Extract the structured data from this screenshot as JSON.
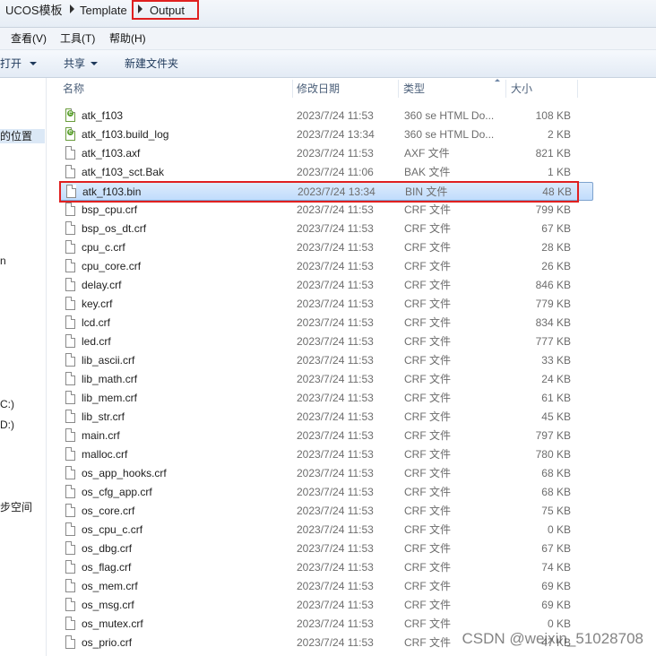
{
  "address": {
    "crumbs": [
      "UCOS模板",
      "Template",
      "Output"
    ]
  },
  "menu": {
    "items": [
      "查看(V)",
      "工具(T)",
      "帮助(H)"
    ]
  },
  "toolbar": {
    "open": "打开",
    "share": "共享",
    "new_folder": "新建文件夹"
  },
  "nav": {
    "items": [
      "的位置",
      "n",
      "C:)",
      "D:)",
      "步空间"
    ]
  },
  "columns": {
    "name": "名称",
    "date": "修改日期",
    "type": "类型",
    "size": "大小"
  },
  "files": [
    {
      "name": "atk_f103",
      "date": "2023/7/24 11:53",
      "type": "360 se HTML Do...",
      "size": "108 KB",
      "icon": "html-file-icon"
    },
    {
      "name": "atk_f103.build_log",
      "date": "2023/7/24 13:34",
      "type": "360 se HTML Do...",
      "size": "2 KB",
      "icon": "html-file-icon"
    },
    {
      "name": "atk_f103.axf",
      "date": "2023/7/24 11:53",
      "type": "AXF 文件",
      "size": "821 KB",
      "icon": "file-icon"
    },
    {
      "name": "atk_f103_sct.Bak",
      "date": "2023/7/24 11:06",
      "type": "BAK 文件",
      "size": "1 KB",
      "icon": "file-icon"
    },
    {
      "name": "atk_f103.bin",
      "date": "2023/7/24 13:34",
      "type": "BIN 文件",
      "size": "48 KB",
      "icon": "file-icon",
      "selected": true
    },
    {
      "name": "bsp_cpu.crf",
      "date": "2023/7/24 11:53",
      "type": "CRF 文件",
      "size": "799 KB",
      "icon": "file-icon"
    },
    {
      "name": "bsp_os_dt.crf",
      "date": "2023/7/24 11:53",
      "type": "CRF 文件",
      "size": "67 KB",
      "icon": "file-icon"
    },
    {
      "name": "cpu_c.crf",
      "date": "2023/7/24 11:53",
      "type": "CRF 文件",
      "size": "28 KB",
      "icon": "file-icon"
    },
    {
      "name": "cpu_core.crf",
      "date": "2023/7/24 11:53",
      "type": "CRF 文件",
      "size": "26 KB",
      "icon": "file-icon"
    },
    {
      "name": "delay.crf",
      "date": "2023/7/24 11:53",
      "type": "CRF 文件",
      "size": "846 KB",
      "icon": "file-icon"
    },
    {
      "name": "key.crf",
      "date": "2023/7/24 11:53",
      "type": "CRF 文件",
      "size": "779 KB",
      "icon": "file-icon"
    },
    {
      "name": "lcd.crf",
      "date": "2023/7/24 11:53",
      "type": "CRF 文件",
      "size": "834 KB",
      "icon": "file-icon"
    },
    {
      "name": "led.crf",
      "date": "2023/7/24 11:53",
      "type": "CRF 文件",
      "size": "777 KB",
      "icon": "file-icon"
    },
    {
      "name": "lib_ascii.crf",
      "date": "2023/7/24 11:53",
      "type": "CRF 文件",
      "size": "33 KB",
      "icon": "file-icon"
    },
    {
      "name": "lib_math.crf",
      "date": "2023/7/24 11:53",
      "type": "CRF 文件",
      "size": "24 KB",
      "icon": "file-icon"
    },
    {
      "name": "lib_mem.crf",
      "date": "2023/7/24 11:53",
      "type": "CRF 文件",
      "size": "61 KB",
      "icon": "file-icon"
    },
    {
      "name": "lib_str.crf",
      "date": "2023/7/24 11:53",
      "type": "CRF 文件",
      "size": "45 KB",
      "icon": "file-icon"
    },
    {
      "name": "main.crf",
      "date": "2023/7/24 11:53",
      "type": "CRF 文件",
      "size": "797 KB",
      "icon": "file-icon"
    },
    {
      "name": "malloc.crf",
      "date": "2023/7/24 11:53",
      "type": "CRF 文件",
      "size": "780 KB",
      "icon": "file-icon"
    },
    {
      "name": "os_app_hooks.crf",
      "date": "2023/7/24 11:53",
      "type": "CRF 文件",
      "size": "68 KB",
      "icon": "file-icon"
    },
    {
      "name": "os_cfg_app.crf",
      "date": "2023/7/24 11:53",
      "type": "CRF 文件",
      "size": "68 KB",
      "icon": "file-icon"
    },
    {
      "name": "os_core.crf",
      "date": "2023/7/24 11:53",
      "type": "CRF 文件",
      "size": "75 KB",
      "icon": "file-icon"
    },
    {
      "name": "os_cpu_c.crf",
      "date": "2023/7/24 11:53",
      "type": "CRF 文件",
      "size": "0 KB",
      "icon": "file-icon"
    },
    {
      "name": "os_dbg.crf",
      "date": "2023/7/24 11:53",
      "type": "CRF 文件",
      "size": "67 KB",
      "icon": "file-icon"
    },
    {
      "name": "os_flag.crf",
      "date": "2023/7/24 11:53",
      "type": "CRF 文件",
      "size": "74 KB",
      "icon": "file-icon"
    },
    {
      "name": "os_mem.crf",
      "date": "2023/7/24 11:53",
      "type": "CRF 文件",
      "size": "69 KB",
      "icon": "file-icon"
    },
    {
      "name": "os_msg.crf",
      "date": "2023/7/24 11:53",
      "type": "CRF 文件",
      "size": "69 KB",
      "icon": "file-icon"
    },
    {
      "name": "os_mutex.crf",
      "date": "2023/7/24 11:53",
      "type": "CRF 文件",
      "size": "0 KB",
      "icon": "file-icon"
    },
    {
      "name": "os_prio.crf",
      "date": "2023/7/24 11:53",
      "type": "CRF 文件",
      "size": "47 KB",
      "icon": "file-icon"
    }
  ],
  "watermark": "CSDN @weixin_51028708",
  "colors": {
    "highlight": "#e02020",
    "selection": "#c1dcfc"
  }
}
